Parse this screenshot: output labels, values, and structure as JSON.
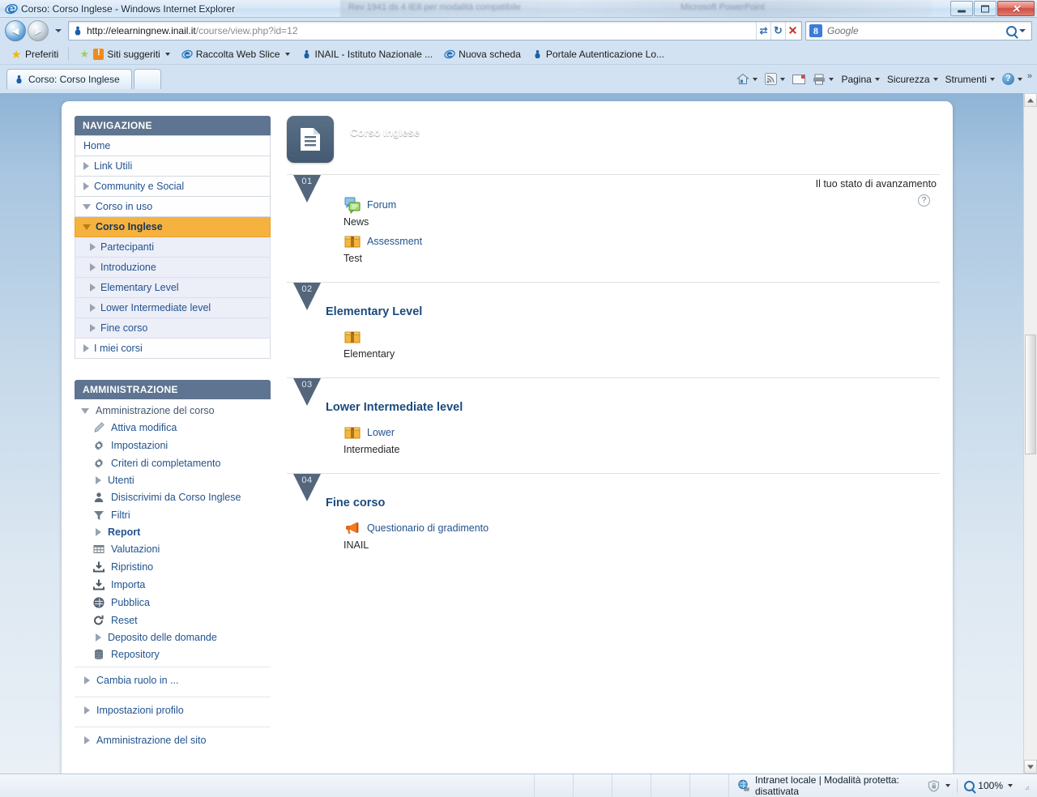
{
  "window": {
    "title": "Corso: Corso Inglese - Windows Internet Explorer",
    "ghost_text_1": "Rev 1941 ds 4 IE8 per modalità compatibile",
    "ghost_text_2": "Microsoft PowerPoint",
    "minimize_label": "Riduci a icona",
    "maximize_label": "Ingrandisci",
    "close_label": "Chiudi"
  },
  "browser": {
    "back_label": "Indietro",
    "forward_label": "Avanti",
    "history_label": "Pagine recenti",
    "url_domain": "http://elearningnew.inail.it",
    "url_path": "/course/view.php?id=12",
    "compat_label": "Visualizzazione compatibilità",
    "refresh_label": "Aggiorna",
    "stop_label": "Interrompi",
    "search_engine": "Google",
    "search_placeholder": "Google",
    "search_label": "Cerca",
    "search_dropdown_label": "Opzioni di ricerca"
  },
  "favorites": {
    "label": "Preferiti",
    "items": [
      {
        "label": "Siti suggeriti",
        "icon": "suggested-sites-icon",
        "has_caret": true
      },
      {
        "label": "Raccolta Web Slice",
        "icon": "web-slice-icon",
        "has_caret": true
      },
      {
        "label": "INAIL - Istituto Nazionale ...",
        "icon": "inail-icon",
        "has_caret": false
      },
      {
        "label": "Nuova scheda",
        "icon": "ie-icon",
        "has_caret": false
      },
      {
        "label": "Portale Autenticazione Lo...",
        "icon": "inail-icon",
        "has_caret": false
      }
    ]
  },
  "tabs": {
    "items": [
      {
        "label": "Corso: Corso Inglese",
        "active": true
      }
    ],
    "new_tab_label": "Nuova scheda"
  },
  "commandbar": {
    "items": [
      {
        "label": "",
        "icon": "home-icon",
        "caret": true
      },
      {
        "label": "",
        "icon": "feeds-icon",
        "caret": true
      },
      {
        "label": "",
        "icon": "mail-icon",
        "caret": false
      },
      {
        "label": "",
        "icon": "print-icon",
        "caret": true
      },
      {
        "label": "Pagina",
        "icon": "",
        "caret": true
      },
      {
        "label": "Sicurezza",
        "icon": "",
        "caret": true
      },
      {
        "label": "Strumenti",
        "icon": "",
        "caret": true
      },
      {
        "label": "",
        "icon": "help-icon",
        "caret": true
      }
    ],
    "overflow": "»"
  },
  "navigation_block": {
    "heading": "NAVIGAZIONE",
    "items": [
      {
        "label": "Home",
        "marker": "none",
        "level": 0,
        "active": false
      },
      {
        "label": "Link Utili",
        "marker": "collapsed",
        "level": 0,
        "active": false
      },
      {
        "label": "Community e Social",
        "marker": "collapsed",
        "level": 0,
        "active": false
      },
      {
        "label": "Corso in uso",
        "marker": "expanded",
        "level": 0,
        "active": false
      },
      {
        "label": "Corso Inglese",
        "marker": "expanded",
        "level": 0,
        "active": true
      },
      {
        "label": "Partecipanti",
        "marker": "collapsed",
        "level": 1,
        "active": false
      },
      {
        "label": "Introduzione",
        "marker": "collapsed",
        "level": 1,
        "active": false
      },
      {
        "label": "Elementary Level",
        "marker": "collapsed",
        "level": 1,
        "active": false
      },
      {
        "label": "Lower Intermediate level",
        "marker": "collapsed",
        "level": 1,
        "active": false
      },
      {
        "label": "Fine corso",
        "marker": "collapsed",
        "level": 1,
        "active": false
      },
      {
        "label": "I miei corsi",
        "marker": "collapsed",
        "level": 0,
        "active": false
      }
    ]
  },
  "administration_block": {
    "heading": "AMMINISTRAZIONE",
    "items": [
      {
        "label": "Amministrazione del corso",
        "icon": "expanded-triangle-icon",
        "level": 0,
        "style": "root"
      },
      {
        "label": "Attiva modifica",
        "icon": "pencil-icon",
        "level": 1,
        "style": "leaf"
      },
      {
        "label": "Impostazioni",
        "icon": "gear-icon",
        "level": 1,
        "style": "leaf"
      },
      {
        "label": "Criteri di completamento",
        "icon": "gear-icon",
        "level": 1,
        "style": "leaf"
      },
      {
        "label": "Utenti",
        "icon": "collapsed-triangle-icon",
        "level": 1,
        "style": "leaf"
      },
      {
        "label": "Disiscrivimi da Corso Inglese",
        "icon": "user-icon",
        "level": 1,
        "style": "leaf"
      },
      {
        "label": "Filtri",
        "icon": "funnel-icon",
        "level": 1,
        "style": "leaf"
      },
      {
        "label": "Report",
        "icon": "collapsed-triangle-icon",
        "level": 1,
        "style": "bold"
      },
      {
        "label": "Valutazioni",
        "icon": "grid-icon",
        "level": 1,
        "style": "leaf"
      },
      {
        "label": "Ripristino",
        "icon": "restore-icon",
        "level": 1,
        "style": "leaf"
      },
      {
        "label": "Importa",
        "icon": "import-icon",
        "level": 1,
        "style": "leaf"
      },
      {
        "label": "Pubblica",
        "icon": "publish-globe-icon",
        "level": 1,
        "style": "leaf"
      },
      {
        "label": "Reset",
        "icon": "reset-icon",
        "level": 1,
        "style": "leaf"
      },
      {
        "label": "Deposito delle domande",
        "icon": "collapsed-triangle-icon",
        "level": 1,
        "style": "leaf"
      },
      {
        "label": "Repository",
        "icon": "database-icon",
        "level": 1,
        "style": "leaf"
      }
    ],
    "footer_items": [
      {
        "label": "Cambia ruolo in ...",
        "icon": "collapsed-triangle-icon"
      },
      {
        "label": "Impostazioni profilo",
        "icon": "collapsed-triangle-icon"
      },
      {
        "label": "Amministrazione del sito",
        "icon": "collapsed-triangle-icon"
      }
    ]
  },
  "course": {
    "title": "Corso Inglese",
    "icon": "course-document-icon",
    "progress_label": "Il tuo stato di avanzamento",
    "help_icon": "question-mark-icon",
    "sections": [
      {
        "number": "01",
        "title": "",
        "activities": [
          {
            "name": "Forum",
            "subtitle": "News",
            "icon": "forum-icon",
            "completion": "none"
          },
          {
            "name": "Assessment",
            "subtitle": "Test",
            "icon": "scorm-package-icon",
            "completion": "auto"
          }
        ]
      },
      {
        "number": "02",
        "title": "Elementary Level",
        "activities": [
          {
            "name": "",
            "subtitle": "Elementary",
            "icon": "scorm-package-icon",
            "completion": "manual"
          }
        ]
      },
      {
        "number": "03",
        "title": "Lower Intermediate level",
        "activities": [
          {
            "name": "Lower",
            "subtitle": "Intermediate",
            "icon": "scorm-package-icon",
            "completion": "manual"
          }
        ]
      },
      {
        "number": "04",
        "title": "Fine corso",
        "activities": [
          {
            "name": "Questionario di gradimento",
            "subtitle": "INAIL",
            "icon": "feedback-megaphone-icon",
            "completion": "auto"
          }
        ]
      }
    ]
  },
  "statusbar": {
    "zone": "Intranet locale | Modalità protetta: disattivata",
    "zone_icon": "globe-icon",
    "protected_mode_icon": "shield-lock-icon",
    "zoom": "100%",
    "zoom_icon": "zoom-magnifier-icon"
  },
  "colors": {
    "accent_orange": "#f6b23f",
    "block_header": "#5e7490",
    "link_blue": "#21538f",
    "section_badge": "#53667c",
    "title_blue": "#1b4a7d"
  }
}
